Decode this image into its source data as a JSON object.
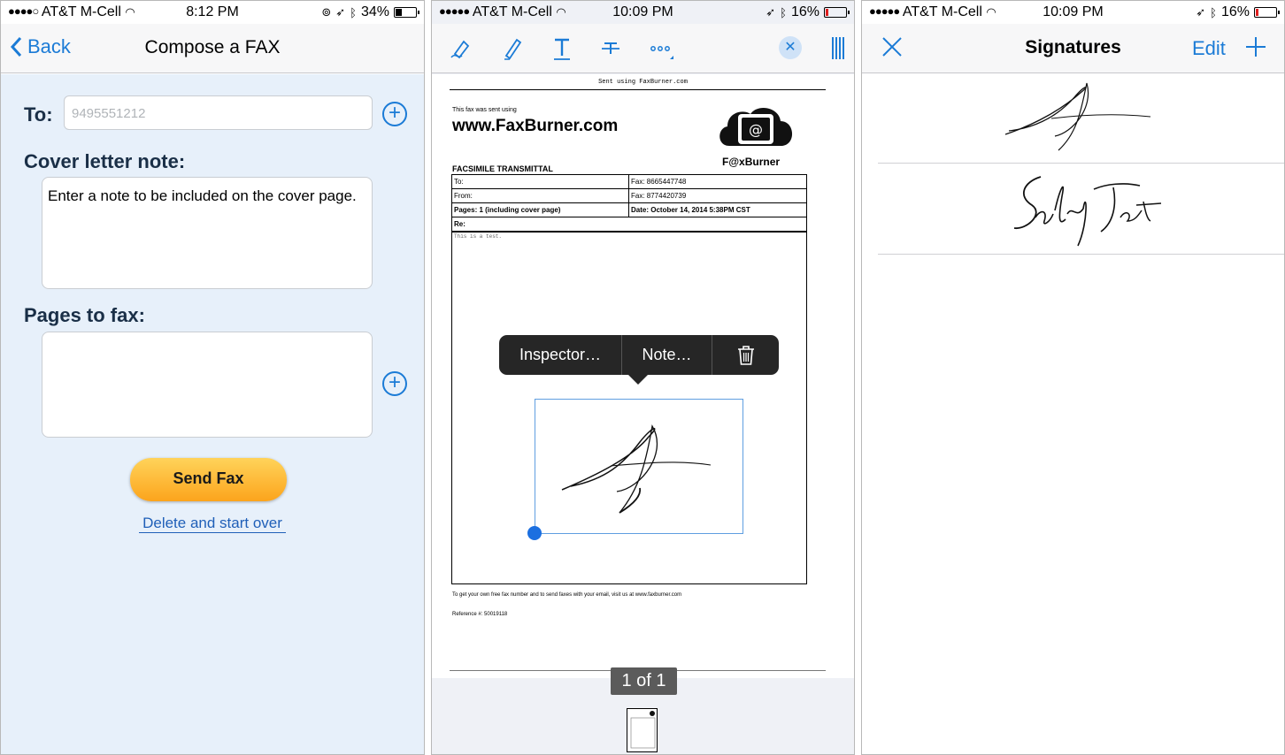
{
  "panel1": {
    "status": {
      "carrier": "AT&T M-Cell",
      "time": "8:12 PM",
      "battery": "34%",
      "battery_level": 0.34
    },
    "nav": {
      "back_label": "Back",
      "title": "Compose a FAX"
    },
    "to_label": "To:",
    "to_placeholder": "9495551212",
    "cover_label": "Cover letter note:",
    "cover_text": "Enter a note to be included on the cover page.",
    "pages_label": "Pages to fax:",
    "send_label": "Send Fax",
    "delete_link": "Delete and start over"
  },
  "panel2": {
    "status": {
      "carrier": "AT&T M-Cell",
      "time": "10:09 PM",
      "battery": "16%",
      "battery_level": 0.16
    },
    "tools": [
      "signature-tool",
      "highlighter-tool",
      "text-tool",
      "strikethrough-tool",
      "more-tool"
    ],
    "doc": {
      "header_small": "Sent using FaxBurner.com",
      "sent_via": "This fax was sent using",
      "site": "www.FaxBurner.com",
      "logo_text": "F@xBurner",
      "transmittal": "FACSIMILE TRANSMITTAL",
      "rows": [
        [
          "To:",
          "Fax: 8665447748"
        ],
        [
          "From:",
          "Fax: 8774420739"
        ],
        [
          "Pages: 1 (including cover page)",
          "Date: October 14, 2014 5:38PM CST"
        ]
      ],
      "re_label": "Re:",
      "body_text": "This is a test.",
      "footer": "To get your own free fax number and to send faxes with your email, visit us at www.faxburner.com",
      "reference": "Reference #: 50019118"
    },
    "popup": {
      "inspector": "Inspector…",
      "note": "Note…"
    },
    "page_indicator": "1 of 1"
  },
  "panel3": {
    "status": {
      "carrier": "AT&T M-Cell",
      "time": "10:09 PM",
      "battery": "16%",
      "battery_level": 0.16
    },
    "nav": {
      "title": "Signatures",
      "edit_label": "Edit"
    }
  }
}
